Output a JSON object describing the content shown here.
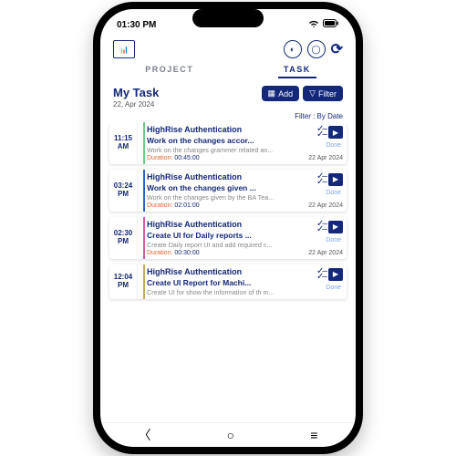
{
  "status": {
    "time": "01:30 PM"
  },
  "tabs": {
    "project": "PROJECT",
    "task": "TASK"
  },
  "header": {
    "title": "My Task",
    "date": "22, Apr 2024",
    "add": "Add",
    "filter": "Filter",
    "filter_label": "Filter : By Date"
  },
  "dur_label": "Duration:",
  "done_label": "Done",
  "tasks": [
    {
      "time": "11:15",
      "ampm": "AM",
      "project": "HighRise Authentication",
      "title": "Work on the changes accor...",
      "desc": "Work on the changes grammer related an...",
      "duration": "00:45:00",
      "date": "22 Apr 2024"
    },
    {
      "time": "03:24",
      "ampm": "PM",
      "project": "HighRise Authentication",
      "title": "Work on the changes given ...",
      "desc": "Work on the changes given by the BA Tea...",
      "duration": "02:01:00",
      "date": "22 Apr 2024"
    },
    {
      "time": "02:30",
      "ampm": "PM",
      "project": "HighRise Authentication",
      "title": "Create UI for Daily reports ...",
      "desc": "Create Daily report UI and add required c...",
      "duration": "00:30:00",
      "date": "22 Apr 2024"
    },
    {
      "time": "12:04",
      "ampm": "PM",
      "project": "HighRise Authentication",
      "title": "Create UI Report for Machi...",
      "desc": "Create UI for show the information of th m...",
      "duration": "",
      "date": ""
    }
  ]
}
